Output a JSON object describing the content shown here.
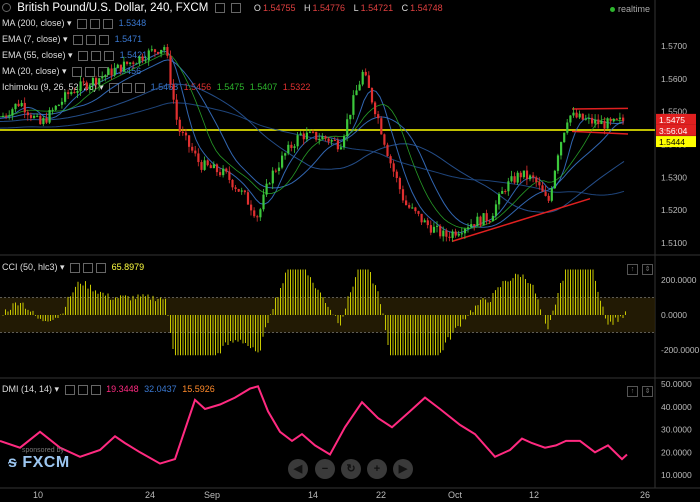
{
  "header": {
    "title": "British Pound/U.S. Dollar, 240, FXCM",
    "ohlc": [
      {
        "k": "O",
        "v": "1.54755"
      },
      {
        "k": "H",
        "v": "1.54776"
      },
      {
        "k": "L",
        "v": "1.54721"
      },
      {
        "k": "C",
        "v": "1.54748"
      }
    ],
    "realtime": "realtime"
  },
  "indicators": [
    {
      "label": "MA (200, close)",
      "values": [
        "1.5348"
      ],
      "color": "#3a78d0"
    },
    {
      "label": "EMA (7, close)",
      "values": [
        "1.5471"
      ],
      "color": "#3a78d0"
    },
    {
      "label": "EMA (55, close)",
      "values": [
        "1.5421"
      ],
      "color": "#3a78d0"
    },
    {
      "label": "MA (20, close)",
      "values": [
        "1.5456"
      ],
      "color": "#3a78d0"
    },
    {
      "label": "Ichimoku (9, 26, 52, 26)",
      "values": [
        "1.5468",
        "1.5456",
        "1.5475",
        "1.5407",
        "1.5322"
      ],
      "colors": [
        "#3a78d0",
        "#e03030",
        "#2db52d",
        "#2db52d",
        "#e03030"
      ]
    }
  ],
  "price_axis": {
    "ticks": [
      "1.5700",
      "1.5600",
      "1.5500",
      "1.5400",
      "1.5300",
      "1.5200",
      "1.5100"
    ],
    "labels": [
      {
        "text": "1.5475",
        "bg": "#e02020",
        "fg": "#ffffff"
      },
      {
        "text": "3:56:04",
        "bg": "#e02020",
        "fg": "#ffffff"
      },
      {
        "text": "1.5444",
        "bg": "#ffff00",
        "fg": "#000000"
      }
    ]
  },
  "cci": {
    "label": "CCI (50, hlc3)",
    "value": "65.8979",
    "ticks": [
      "200.0000",
      "0.0000",
      "-200.0000"
    ],
    "color": "#c8c800"
  },
  "dmi": {
    "label": "DMI (14, 14)",
    "values": [
      {
        "v": "19.3448",
        "color": "#ff2a80"
      },
      {
        "v": "32.0437",
        "color": "#3a78d0"
      },
      {
        "v": "15.5926",
        "color": "#ff8a2a"
      }
    ],
    "ticks": [
      "50.0000",
      "40.0000",
      "30.0000",
      "20.0000",
      "10.0000"
    ]
  },
  "x_axis": {
    "labels": [
      "10",
      "24",
      "Sep",
      "14",
      "22",
      "Oct",
      "12",
      "26"
    ]
  },
  "logo": {
    "small": "sponsored by",
    "big": "FXCM"
  },
  "controls": [
    "◀",
    "−",
    "↻",
    "+",
    "▶"
  ],
  "colors": {
    "bull": "#3cc83c",
    "bear": "#e03030",
    "level": "#ffff00",
    "trend": "#e02020",
    "dmi": "#ff2a80"
  }
}
